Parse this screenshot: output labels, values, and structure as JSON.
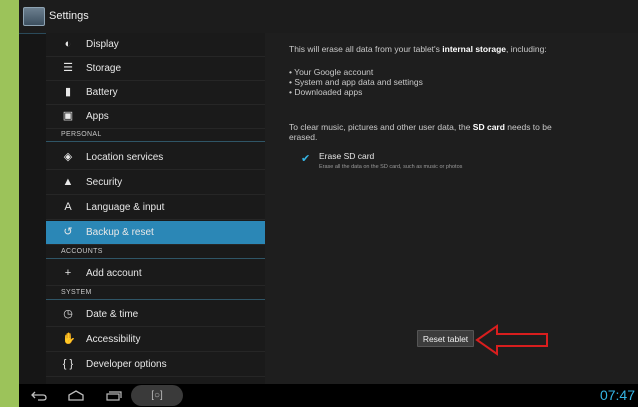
{
  "titlebar": {
    "title": "Settings"
  },
  "sidebar": {
    "items": [
      {
        "label": "Display",
        "icon": "◐"
      },
      {
        "label": "Storage",
        "icon": "☰"
      },
      {
        "label": "Battery",
        "icon": "▮"
      },
      {
        "label": "Apps",
        "icon": "▣"
      },
      {
        "label": "Location services",
        "icon": "◈"
      },
      {
        "label": "Security",
        "icon": "▲"
      },
      {
        "label": "Language & input",
        "icon": "A"
      },
      {
        "label": "Backup & reset",
        "icon": "↺"
      },
      {
        "label": "Add account",
        "icon": "+"
      },
      {
        "label": "Date & time",
        "icon": "◷"
      },
      {
        "label": "Accessibility",
        "icon": "✋"
      },
      {
        "label": "Developer options",
        "icon": "{ }"
      }
    ],
    "sections": [
      "PERSONAL",
      "ACCOUNTS",
      "SYSTEM"
    ]
  },
  "content": {
    "intro_prefix": "This will erase all data from your tablet's ",
    "intro_bold": "internal storage",
    "intro_suffix": ", including:",
    "bullets": [
      "• Your Google account",
      "• System and app data and settings",
      "• Downloaded apps"
    ],
    "sd_line1_prefix": "To clear music, pictures and other user data, the ",
    "sd_line1_bold": "SD card",
    "sd_line1_suffix": " needs to be",
    "sd_line2": "erased.",
    "erase_title": "Erase SD card",
    "erase_summary": "Erase all the data on the SD card, such as music or photos",
    "erase_checked": true,
    "reset_button": "Reset tablet"
  },
  "navbar": {
    "back_icon": "back-arrow",
    "home_icon": "home",
    "recents_icon": "recent-apps",
    "screenshot_icon": "[○]",
    "clock": "07:47"
  },
  "colors": {
    "accent": "#35b5e5",
    "selected": "#2b87b6",
    "arrow": "#d81e1e"
  }
}
